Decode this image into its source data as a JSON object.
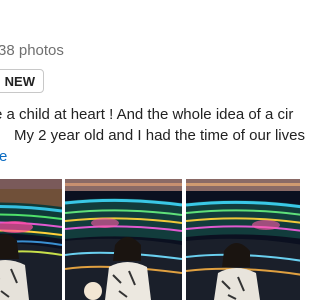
{
  "review": {
    "photo_count": "38 photos",
    "badge": "NEW",
    "text_lines": [
      "e a child at heart ! And the whole idea of a cir",
      "My 2 year old and I had the time of our lives"
    ],
    "more_label": "re"
  },
  "photos": [
    {
      "name": "review-photo-1"
    },
    {
      "name": "review-photo-2"
    },
    {
      "name": "review-photo-3"
    }
  ]
}
